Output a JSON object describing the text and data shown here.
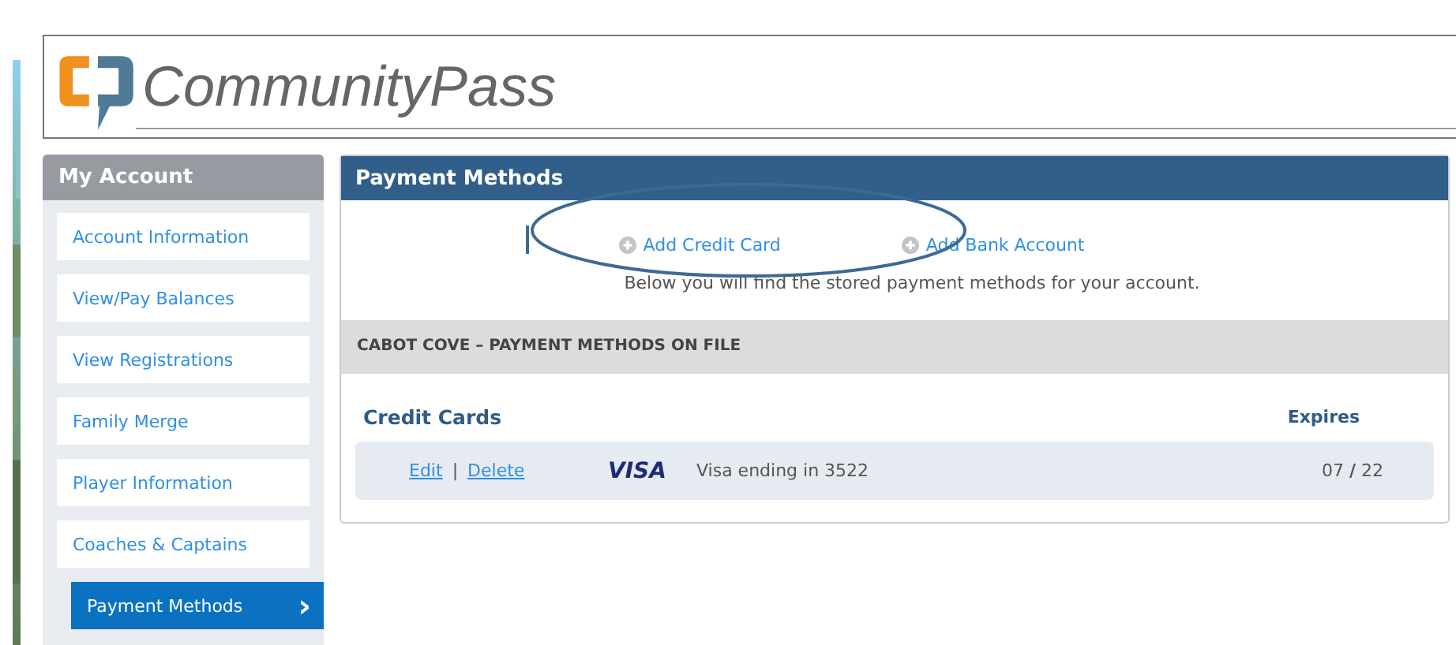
{
  "header": {
    "brand": "CommunityPass"
  },
  "sidebar": {
    "title": "My Account",
    "items": [
      {
        "label": "Account Information",
        "selected": false
      },
      {
        "label": "View/Pay Balances",
        "selected": false
      },
      {
        "label": "View Registrations",
        "selected": false
      },
      {
        "label": "Family Merge",
        "selected": false
      },
      {
        "label": "Player Information",
        "selected": false
      },
      {
        "label": "Coaches & Captains",
        "selected": false
      },
      {
        "label": "Payment Methods",
        "selected": true,
        "chevron": "›"
      }
    ]
  },
  "panel": {
    "title": "Payment Methods",
    "actions": [
      "Add Credit Card",
      "Add Bank Account"
    ],
    "note": "Below you will find the stored payment methods for your account.",
    "section_title": "CABOT COVE – PAYMENT METHODS ON FILE",
    "cards_heading": "Credit Cards",
    "expires_heading": "Expires",
    "cards": [
      {
        "links": [
          "Edit",
          "Delete"
        ],
        "separator": "|",
        "brand": "VISA",
        "description": "Visa ending in 3522",
        "expires": "07 **/** 22"
      }
    ]
  }
}
